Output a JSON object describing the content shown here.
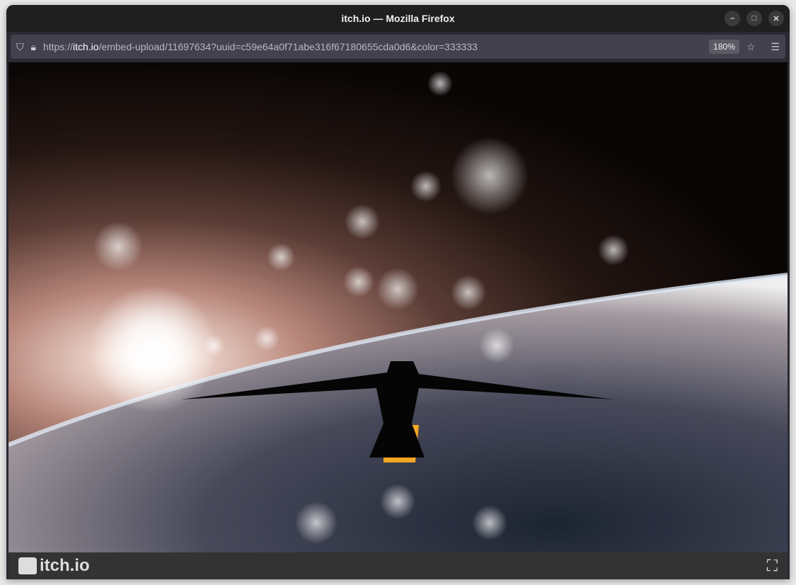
{
  "window": {
    "title": "itch.io — Mozilla Firefox"
  },
  "urlbar": {
    "scheme": "https://",
    "host": "itch.io",
    "path": "/embed-upload/11697634?uuid=c59e64a0f71abe316f67180655cda0d6&color=333333",
    "zoom": "180%"
  },
  "footer": {
    "logo_text": "itch.io",
    "bar_color": "#333333"
  },
  "icons": [
    "shield-icon",
    "lock-icon",
    "star-icon",
    "hamburger-menu-icon",
    "itchio-logo-icon",
    "fullscreen-icon",
    "minimize-icon",
    "maximize-icon",
    "close-icon"
  ]
}
